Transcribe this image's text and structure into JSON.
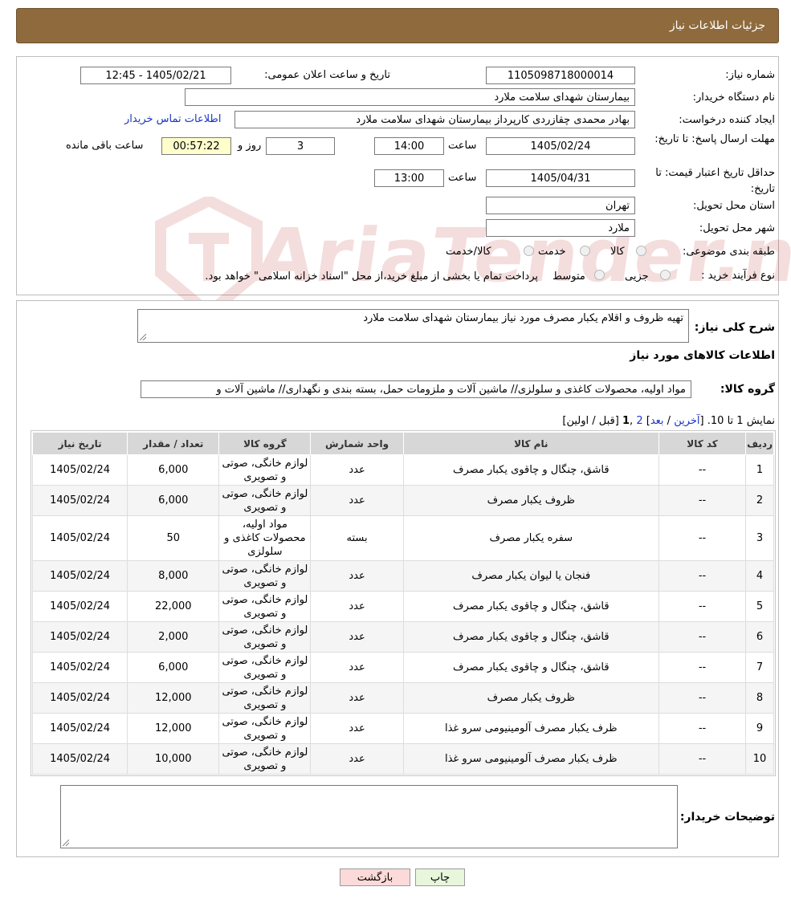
{
  "header": {
    "title": "جزئیات اطلاعات نیاز"
  },
  "form": {
    "need_number_label": "شماره نیاز:",
    "need_number": "1105098718000014",
    "announce_label": "تاریخ و ساعت اعلان عمومی:",
    "announce_value": "1405/02/21 - 12:45",
    "buyer_org_label": "نام دستگاه خریدار:",
    "buyer_org": "بیمارستان شهدای سلامت ملارد",
    "creator_label": "ایجاد کننده درخواست:",
    "creator": "بهادر محمدی چقازردی کارپرداز بیمارستان شهدای سلامت ملارد",
    "contact_link": "اطلاعات تماس خریدار",
    "deadline_label": "مهلت ارسال پاسخ: تا تاریخ:",
    "deadline_date": "1405/02/24",
    "time_label": "ساعت",
    "deadline_time": "14:00",
    "days_value": "3",
    "days_label": "روز و",
    "remaining_value": "00:57:22",
    "remaining_label": "ساعت باقی مانده",
    "price_validity_label": "حداقل تاریخ اعتبار قیمت: تا تاریخ:",
    "price_validity_date": "1405/04/31",
    "price_validity_time": "13:00",
    "province_label": "استان محل تحویل:",
    "province": "تهران",
    "city_label": "شهر محل تحویل:",
    "city": "ملارد",
    "category_label": "طبقه بندی موضوعی:",
    "category_options": [
      "کالا",
      "خدمت",
      "کالا/خدمت"
    ],
    "process_label": "نوع فرآیند خرید :",
    "process_options": [
      "جزیی",
      "متوسط"
    ],
    "process_note": "پرداخت تمام یا بخشی از مبلغ خرید،از محل \"اسناد خزانه اسلامی\" خواهد بود."
  },
  "watermark": {
    "text": "AriaTender.neT"
  },
  "summary": {
    "label": "شرح کلی نیاز:",
    "value": "تهیه ظروف و اقلام یکبار مصرف مورد نیاز بیمارستان شهدای سلامت ملارد"
  },
  "goods": {
    "section_title": "اطلاعات کالاهای مورد نیاز",
    "group_label": "گروه کالا:",
    "group_value": "مواد اولیه، محصولات کاغذی و سلولزی// ماشین آلات و ملزومات حمل، بسته بندی و نگهداری// ماشین آلات و"
  },
  "pagination": {
    "showing": "نمایش 1 تا 10.",
    "bracket_open": "[",
    "last": "آخرین",
    "sep1": "/",
    "next": "بعد",
    "bracket_close": "]",
    "page2": "2",
    "comma": ",",
    "page1": "1",
    "prev_first": "[قبل / اولین]"
  },
  "table": {
    "headers": [
      "ردیف",
      "کد کالا",
      "نام کالا",
      "واحد شمارش",
      "گروه کالا",
      "تعداد / مقدار",
      "تاریخ نیاز"
    ],
    "rows": [
      {
        "row": "1",
        "code": "--",
        "name": "قاشق، چنگال و چاقوی یکبار مصرف",
        "unit": "عدد",
        "group": "لوازم خانگی، صوتی و تصویری",
        "qty": "6,000",
        "date": "1405/02/24"
      },
      {
        "row": "2",
        "code": "--",
        "name": "ظروف یکبار مصرف",
        "unit": "عدد",
        "group": "لوازم خانگی، صوتی و تصویری",
        "qty": "6,000",
        "date": "1405/02/24"
      },
      {
        "row": "3",
        "code": "--",
        "name": "سفره یکبار مصرف",
        "unit": "بسته",
        "group": "مواد اولیه، محصولات کاغذی و سلولزی",
        "qty": "50",
        "date": "1405/02/24"
      },
      {
        "row": "4",
        "code": "--",
        "name": "فنجان یا لیوان یکبار مصرف",
        "unit": "عدد",
        "group": "لوازم خانگی، صوتی و تصویری",
        "qty": "8,000",
        "date": "1405/02/24"
      },
      {
        "row": "5",
        "code": "--",
        "name": "قاشق، چنگال و چاقوی یکبار مصرف",
        "unit": "عدد",
        "group": "لوازم خانگی، صوتی و تصویری",
        "qty": "22,000",
        "date": "1405/02/24"
      },
      {
        "row": "6",
        "code": "--",
        "name": "قاشق، چنگال و چاقوی یکبار مصرف",
        "unit": "عدد",
        "group": "لوازم خانگی، صوتی و تصویری",
        "qty": "2,000",
        "date": "1405/02/24"
      },
      {
        "row": "7",
        "code": "--",
        "name": "قاشق، چنگال و چاقوی یکبار مصرف",
        "unit": "عدد",
        "group": "لوازم خانگی، صوتی و تصویری",
        "qty": "6,000",
        "date": "1405/02/24"
      },
      {
        "row": "8",
        "code": "--",
        "name": "ظروف یکبار مصرف",
        "unit": "عدد",
        "group": "لوازم خانگی، صوتی و تصویری",
        "qty": "12,000",
        "date": "1405/02/24"
      },
      {
        "row": "9",
        "code": "--",
        "name": "ظرف یکبار مصرف آلومینیومی سرو غذا",
        "unit": "عدد",
        "group": "لوازم خانگی، صوتی و تصویری",
        "qty": "12,000",
        "date": "1405/02/24"
      },
      {
        "row": "10",
        "code": "--",
        "name": "ظرف یکبار مصرف آلومینیومی سرو غذا",
        "unit": "عدد",
        "group": "لوازم خانگی، صوتی و تصویری",
        "qty": "10,000",
        "date": "1405/02/24"
      }
    ]
  },
  "buyer_notes": {
    "label": "توضیحات خریدار:",
    "value": ""
  },
  "buttons": {
    "print": "چاپ",
    "back": "بازگشت"
  },
  "colors": {
    "header_bg": "#8e6a3c",
    "link": "#1a35c4",
    "back_button_bg": "#fcdada",
    "print_button_bg": "#e8f7dc"
  }
}
